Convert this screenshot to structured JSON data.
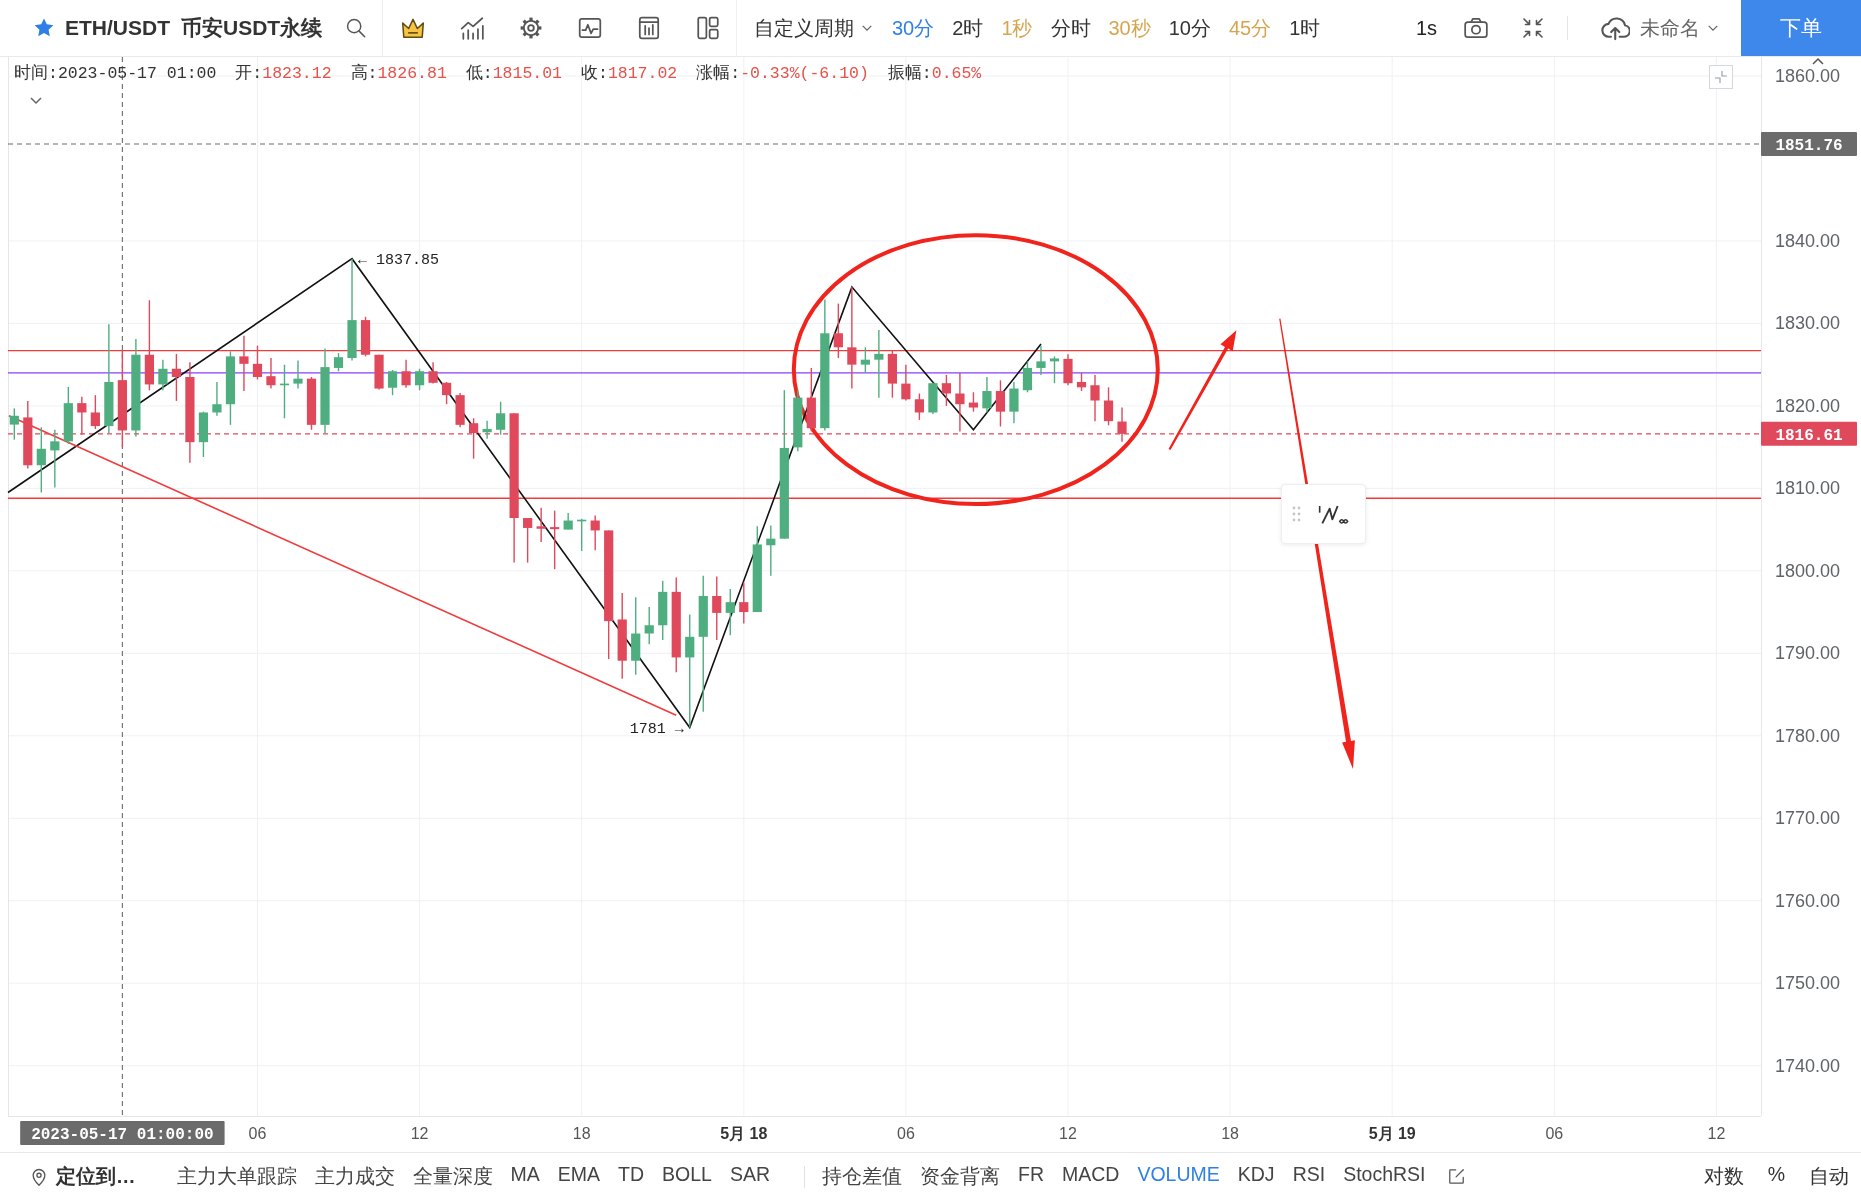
{
  "toolbar": {
    "pair": "ETH/USDT",
    "market": "币安USDT永续",
    "period_menu": "自定义周期",
    "periods": [
      {
        "label": "30分",
        "selected": true
      },
      {
        "label": "2时",
        "selected": false
      },
      {
        "label": "1秒",
        "selected": false,
        "color": "#d6a550"
      },
      {
        "label": "分时",
        "selected": false
      },
      {
        "label": "30秒",
        "selected": false,
        "color": "#d6a550"
      },
      {
        "label": "10分",
        "selected": false
      },
      {
        "label": "45分",
        "selected": false,
        "color": "#d6a550"
      },
      {
        "label": "1时",
        "selected": false
      }
    ],
    "tick_interval": "1s",
    "layout_name": "未命名",
    "order_button": "下单"
  },
  "ohlc_info": [
    {
      "label": "时间:",
      "value": "2023-05-17 01:00",
      "color": "#333333"
    },
    {
      "label": "开:",
      "value": "1823.12",
      "color": "#e4524b"
    },
    {
      "label": "高:",
      "value": "1826.81",
      "color": "#e4524b"
    },
    {
      "label": "低:",
      "value": "1815.01",
      "color": "#e4524b"
    },
    {
      "label": "收:",
      "value": "1817.02",
      "color": "#e4524b"
    },
    {
      "label": "涨幅:",
      "value": "-0.33%(-6.10)",
      "color": "#e4524b"
    },
    {
      "label": "振幅:",
      "value": "0.65%",
      "color": "#e4524b"
    }
  ],
  "chart_data": [
    {
      "type": "candlestick",
      "xlim": [
        "2023-05-16T20:46",
        "2023-05-19T13:39"
      ],
      "ylim": [
        1733.9,
        1862.3
      ],
      "xticks": [
        {
          "value": "2023-05-17T06:00",
          "label": "06"
        },
        {
          "value": "2023-05-17T12:00",
          "label": "12"
        },
        {
          "value": "2023-05-17T18:00",
          "label": "18"
        },
        {
          "value": "2023-05-18T00:00",
          "label": "5月 18"
        },
        {
          "value": "2023-05-18T06:00",
          "label": "06"
        },
        {
          "value": "2023-05-18T12:00",
          "label": "12"
        },
        {
          "value": "2023-05-18T18:00",
          "label": "18"
        },
        {
          "value": "2023-05-19T00:00",
          "label": "5月 19"
        },
        {
          "value": "2023-05-19T06:00",
          "label": "06"
        },
        {
          "value": "2023-05-19T12:00",
          "label": "12"
        }
      ],
      "yticks": [
        {
          "value": 1740,
          "label": "1740.00"
        },
        {
          "value": 1750,
          "label": "1750.00"
        },
        {
          "value": 1760,
          "label": "1760.00"
        },
        {
          "value": 1770,
          "label": "1770.00"
        },
        {
          "value": 1780,
          "label": "1780.00"
        },
        {
          "value": 1790,
          "label": "1790.00"
        },
        {
          "value": 1800,
          "label": "1800.00"
        },
        {
          "value": 1810,
          "label": "1810.00"
        },
        {
          "value": 1820,
          "label": "1820.00"
        },
        {
          "value": 1830,
          "label": "1830.00"
        },
        {
          "value": 1840,
          "label": "1840.00"
        },
        {
          "value": 1860,
          "label": "1860.00"
        }
      ],
      "grid": true,
      "series": [
        {
          "type": "candlestick",
          "x": [
            "2023-05-16T21:00",
            "2023-05-16T21:30",
            "2023-05-16T22:00",
            "2023-05-16T22:30",
            "2023-05-16T23:00",
            "2023-05-16T23:30",
            "2023-05-17T00:00",
            "2023-05-17T00:30",
            "2023-05-17T01:00",
            "2023-05-17T01:30",
            "2023-05-17T02:00",
            "2023-05-17T02:30",
            "2023-05-17T03:00",
            "2023-05-17T03:30",
            "2023-05-17T04:00",
            "2023-05-17T04:30",
            "2023-05-17T05:00",
            "2023-05-17T05:30",
            "2023-05-17T06:00",
            "2023-05-17T06:30",
            "2023-05-17T07:00",
            "2023-05-17T07:30",
            "2023-05-17T08:00",
            "2023-05-17T08:30",
            "2023-05-17T09:00",
            "2023-05-17T09:30",
            "2023-05-17T10:00",
            "2023-05-17T10:30",
            "2023-05-17T11:00",
            "2023-05-17T11:30",
            "2023-05-17T12:00",
            "2023-05-17T12:30",
            "2023-05-17T13:00",
            "2023-05-17T13:30",
            "2023-05-17T14:00",
            "2023-05-17T14:30",
            "2023-05-17T15:00",
            "2023-05-17T15:30",
            "2023-05-17T16:00",
            "2023-05-17T16:30",
            "2023-05-17T17:00",
            "2023-05-17T17:30",
            "2023-05-17T18:00",
            "2023-05-17T18:30",
            "2023-05-17T19:00",
            "2023-05-17T19:30",
            "2023-05-17T20:00",
            "2023-05-17T20:30",
            "2023-05-17T21:00",
            "2023-05-17T21:30",
            "2023-05-17T22:00",
            "2023-05-17T22:30",
            "2023-05-17T23:00",
            "2023-05-17T23:30",
            "2023-05-18T00:00",
            "2023-05-18T00:30",
            "2023-05-18T01:00",
            "2023-05-18T01:30",
            "2023-05-18T02:00",
            "2023-05-18T02:30",
            "2023-05-18T03:00",
            "2023-05-18T03:30",
            "2023-05-18T04:00",
            "2023-05-18T04:30",
            "2023-05-18T05:00",
            "2023-05-18T05:30",
            "2023-05-18T06:00",
            "2023-05-18T06:30",
            "2023-05-18T07:00",
            "2023-05-18T07:30",
            "2023-05-18T08:00",
            "2023-05-18T08:30",
            "2023-05-18T09:00",
            "2023-05-18T09:30",
            "2023-05-18T10:00",
            "2023-05-18T10:30",
            "2023-05-18T11:00",
            "2023-05-18T11:30",
            "2023-05-18T12:00",
            "2023-05-18T12:30",
            "2023-05-18T13:00",
            "2023-05-18T13:30",
            "2023-05-18T14:00"
          ],
          "ohlc": [
            [
              1817.73,
              1819.7,
              1815.9,
              1818.8
            ],
            [
              1818.6,
              1820.6,
              1812.4,
              1812.8
            ],
            [
              1812.8,
              1817.4,
              1809.5,
              1814.8
            ],
            [
              1814.6,
              1817.1,
              1810.1,
              1815.7
            ],
            [
              1815.7,
              1822.3,
              1815.4,
              1820.33
            ],
            [
              1820.33,
              1821.1,
              1816.5,
              1819.2
            ],
            [
              1819.2,
              1821.3,
              1817.2,
              1817.55
            ],
            [
              1817.55,
              1829.9,
              1816.7,
              1822.9
            ],
            [
              1823.12,
              1826.81,
              1815.01,
              1817.02
            ],
            [
              1817.02,
              1828.1,
              1816.3,
              1826.2
            ],
            [
              1826.2,
              1832.8,
              1821.9,
              1822.6
            ],
            [
              1822.6,
              1825.6,
              1821.9,
              1824.5
            ],
            [
              1824.5,
              1826.3,
              1820.6,
              1823.5
            ],
            [
              1823.5,
              1825.3,
              1813.1,
              1815.6
            ],
            [
              1815.6,
              1819.3,
              1813.8,
              1819.2
            ],
            [
              1819.2,
              1822.9,
              1818.8,
              1820.2
            ],
            [
              1820.2,
              1826.6,
              1817.7,
              1826.0
            ],
            [
              1826.0,
              1828.5,
              1821.8,
              1825.1
            ],
            [
              1825.1,
              1827.3,
              1823.2,
              1823.5
            ],
            [
              1823.6,
              1825.8,
              1822.1,
              1822.5
            ],
            [
              1822.5,
              1825.0,
              1818.5,
              1822.7
            ],
            [
              1822.7,
              1825.5,
              1822.1,
              1823.3
            ],
            [
              1823.3,
              1823.5,
              1817.1,
              1817.7
            ],
            [
              1817.7,
              1826.95,
              1816.7,
              1824.7
            ],
            [
              1824.6,
              1826.4,
              1824.2,
              1825.9
            ],
            [
              1825.8,
              1837.85,
              1825.5,
              1830.4
            ],
            [
              1830.4,
              1830.8,
              1826.0,
              1826.2
            ],
            [
              1826.2,
              1826.2,
              1822.0,
              1822.1
            ],
            [
              1822.2,
              1824.35,
              1821.3,
              1824.2
            ],
            [
              1824.2,
              1825.6,
              1822.2,
              1822.5
            ],
            [
              1822.5,
              1824.5,
              1821.9,
              1824.2
            ],
            [
              1824.2,
              1825.3,
              1822.7,
              1822.8
            ],
            [
              1822.8,
              1822.9,
              1820.2,
              1821.3
            ],
            [
              1821.3,
              1821.55,
              1817.4,
              1817.7
            ],
            [
              1817.9,
              1818.5,
              1813.6,
              1816.7
            ],
            [
              1816.8,
              1818.2,
              1816.0,
              1817.2
            ],
            [
              1817.1,
              1820.5,
              1816.5,
              1819.1
            ],
            [
              1819.1,
              1819.1,
              1801.0,
              1806.4
            ],
            [
              1806.4,
              1806.4,
              1801.0,
              1805.2
            ],
            [
              1805.4,
              1807.65,
              1803.5,
              1805.1
            ],
            [
              1805.3,
              1807.3,
              1800.2,
              1805.05
            ],
            [
              1805.0,
              1807.0,
              1805.0,
              1806.1
            ],
            [
              1806.0,
              1806.3,
              1802.4,
              1806.2
            ],
            [
              1806.1,
              1806.7,
              1802.5,
              1804.9
            ],
            [
              1804.9,
              1804.9,
              1789.3,
              1793.9
            ],
            [
              1794.1,
              1797.3,
              1786.9,
              1789.1
            ],
            [
              1789.1,
              1796.8,
              1787.4,
              1792.4
            ],
            [
              1792.4,
              1795.6,
              1791.1,
              1793.4
            ],
            [
              1793.4,
              1798.8,
              1791.6,
              1797.45
            ],
            [
              1797.45,
              1799.2,
              1787.7,
              1789.5
            ],
            [
              1789.5,
              1794.7,
              1781.0,
              1792.0
            ],
            [
              1792.0,
              1799.4,
              1782.9,
              1796.95
            ],
            [
              1796.95,
              1799.3,
              1791.6,
              1794.9
            ],
            [
              1794.9,
              1797.8,
              1792.2,
              1796.2
            ],
            [
              1796.2,
              1798.6,
              1793.6,
              1795.0
            ],
            [
              1795.0,
              1805.4,
              1795.0,
              1803.2
            ],
            [
              1803.1,
              1805.5,
              1799.4,
              1803.9
            ],
            [
              1803.9,
              1821.9,
              1803.9,
              1814.9
            ],
            [
              1814.97,
              1822.0,
              1814.5,
              1821.0
            ],
            [
              1821.0,
              1824.6,
              1816.9,
              1817.3
            ],
            [
              1817.3,
              1832.9,
              1817.0,
              1828.8
            ],
            [
              1828.8,
              1832.4,
              1825.8,
              1827.1
            ],
            [
              1827.1,
              1834.4,
              1822.1,
              1825.0
            ],
            [
              1825.0,
              1827.1,
              1824.0,
              1825.6
            ],
            [
              1825.6,
              1829.2,
              1821.0,
              1826.3
            ],
            [
              1826.3,
              1826.7,
              1821.0,
              1822.7
            ],
            [
              1822.7,
              1825.0,
              1820.65,
              1820.8
            ],
            [
              1820.8,
              1821.5,
              1818.3,
              1819.2
            ],
            [
              1819.2,
              1822.8,
              1819.0,
              1822.75
            ],
            [
              1822.75,
              1823.75,
              1820.0,
              1821.5
            ],
            [
              1821.5,
              1824.0,
              1816.9,
              1820.2
            ],
            [
              1820.4,
              1821.65,
              1819.3,
              1819.8
            ],
            [
              1819.7,
              1823.5,
              1819.2,
              1821.8
            ],
            [
              1821.8,
              1823.1,
              1817.5,
              1819.3
            ],
            [
              1819.3,
              1822.9,
              1817.9,
              1822.1
            ],
            [
              1821.9,
              1825.4,
              1821.65,
              1824.6
            ],
            [
              1824.6,
              1827.3,
              1823.75,
              1825.4
            ],
            [
              1825.4,
              1826.0,
              1822.75,
              1825.75
            ],
            [
              1825.7,
              1826.25,
              1822.5,
              1822.75
            ],
            [
              1822.9,
              1824.0,
              1821.8,
              1822.25
            ],
            [
              1822.5,
              1823.75,
              1818.15,
              1820.65
            ],
            [
              1820.65,
              1822.25,
              1817.65,
              1818.15
            ],
            [
              1818.1,
              1819.8,
              1815.65,
              1816.61
            ]
          ]
        },
        {
          "type": "line",
          "color": "#111111",
          "x": [
            "2023-05-16T20:46",
            "2023-05-17T09:30",
            "2023-05-17T22:00",
            "2023-05-18T04:00",
            "2023-05-18T08:30",
            "2023-05-18T11:00"
          ],
          "values": [
            1809.5,
            1837.85,
            1781,
            1834.4,
            1817.1,
            1827.5
          ]
        },
        {
          "type": "line",
          "color": "#f03c3c",
          "x": [
            "2023-05-16T20:48",
            "2023-05-17T21:30"
          ],
          "values": [
            1818.8,
            1782.5
          ]
        }
      ],
      "ref_lines": [
        {
          "axis": "x",
          "value": "2023-05-17T01:00",
          "label": "2023-05-17 01:00:00",
          "color": "#6b6b6b",
          "line_style": "dashed"
        },
        {
          "axis": "y",
          "value": 1851.76,
          "label": "1851.76",
          "color": "#6b6b6b",
          "line_style": "dashed"
        },
        {
          "axis": "y",
          "value": 1826.7,
          "color": "#f23b3b",
          "line_style": "solid"
        },
        {
          "axis": "y",
          "value": 1824.0,
          "color": "#8a3ffc",
          "line_style": "solid"
        },
        {
          "axis": "y",
          "value": 1816.61,
          "label": "1816.61",
          "color": "#e0485b",
          "line_style": "dashed"
        },
        {
          "axis": "y",
          "value": 1808.8,
          "color": "#f23b3b",
          "line_style": "solid"
        }
      ],
      "annotations": [
        "← 1837.85",
        "1781 →"
      ]
    }
  ],
  "bottom_bar": {
    "locate": "定位到…",
    "main_indicators": [
      {
        "label": "主力大单跟踪",
        "selected": false
      },
      {
        "label": "主力成交",
        "selected": false
      },
      {
        "label": "全量深度",
        "selected": false
      },
      {
        "label": "MA",
        "selected": false
      },
      {
        "label": "EMA",
        "selected": false
      },
      {
        "label": "TD",
        "selected": false
      },
      {
        "label": "BOLL",
        "selected": false
      },
      {
        "label": "SAR",
        "selected": false
      }
    ],
    "sub_indicators": [
      {
        "label": "持仓差值",
        "selected": false
      },
      {
        "label": "资金背离",
        "selected": false
      },
      {
        "label": "FR",
        "selected": false
      },
      {
        "label": "MACD",
        "selected": false
      },
      {
        "label": "VOLUME",
        "selected": true
      },
      {
        "label": "KDJ",
        "selected": false
      },
      {
        "label": "RSI",
        "selected": false
      },
      {
        "label": "StochRSI",
        "selected": false
      }
    ],
    "scale_options": [
      "对数",
      "%",
      "自动"
    ]
  }
}
